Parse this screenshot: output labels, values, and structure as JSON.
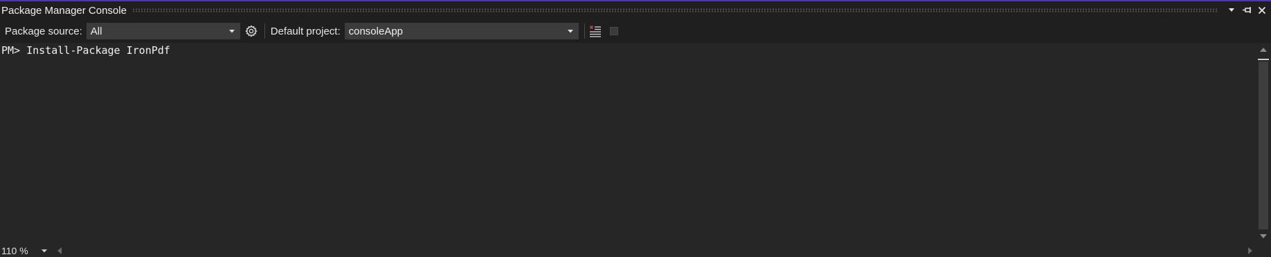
{
  "window": {
    "title": "Package Manager Console",
    "accent_color": "#4f3aa8",
    "title_buttons": [
      {
        "name": "window-position-menu",
        "icon": "triangle-down-icon"
      },
      {
        "name": "pin",
        "icon": "pin-icon"
      },
      {
        "name": "close",
        "icon": "close-icon"
      }
    ]
  },
  "toolbar": {
    "package_source_label": "Package source:",
    "package_source_value": "All",
    "settings_icon": "gear-icon",
    "default_project_label": "Default project:",
    "default_project_value": "consoleApp",
    "clear_icon": "clear-console-icon",
    "stop_icon": "stop-icon"
  },
  "console": {
    "lines": [
      "PM> Install-Package IronPdf"
    ]
  },
  "statusbar": {
    "zoom_value": "110 %"
  }
}
